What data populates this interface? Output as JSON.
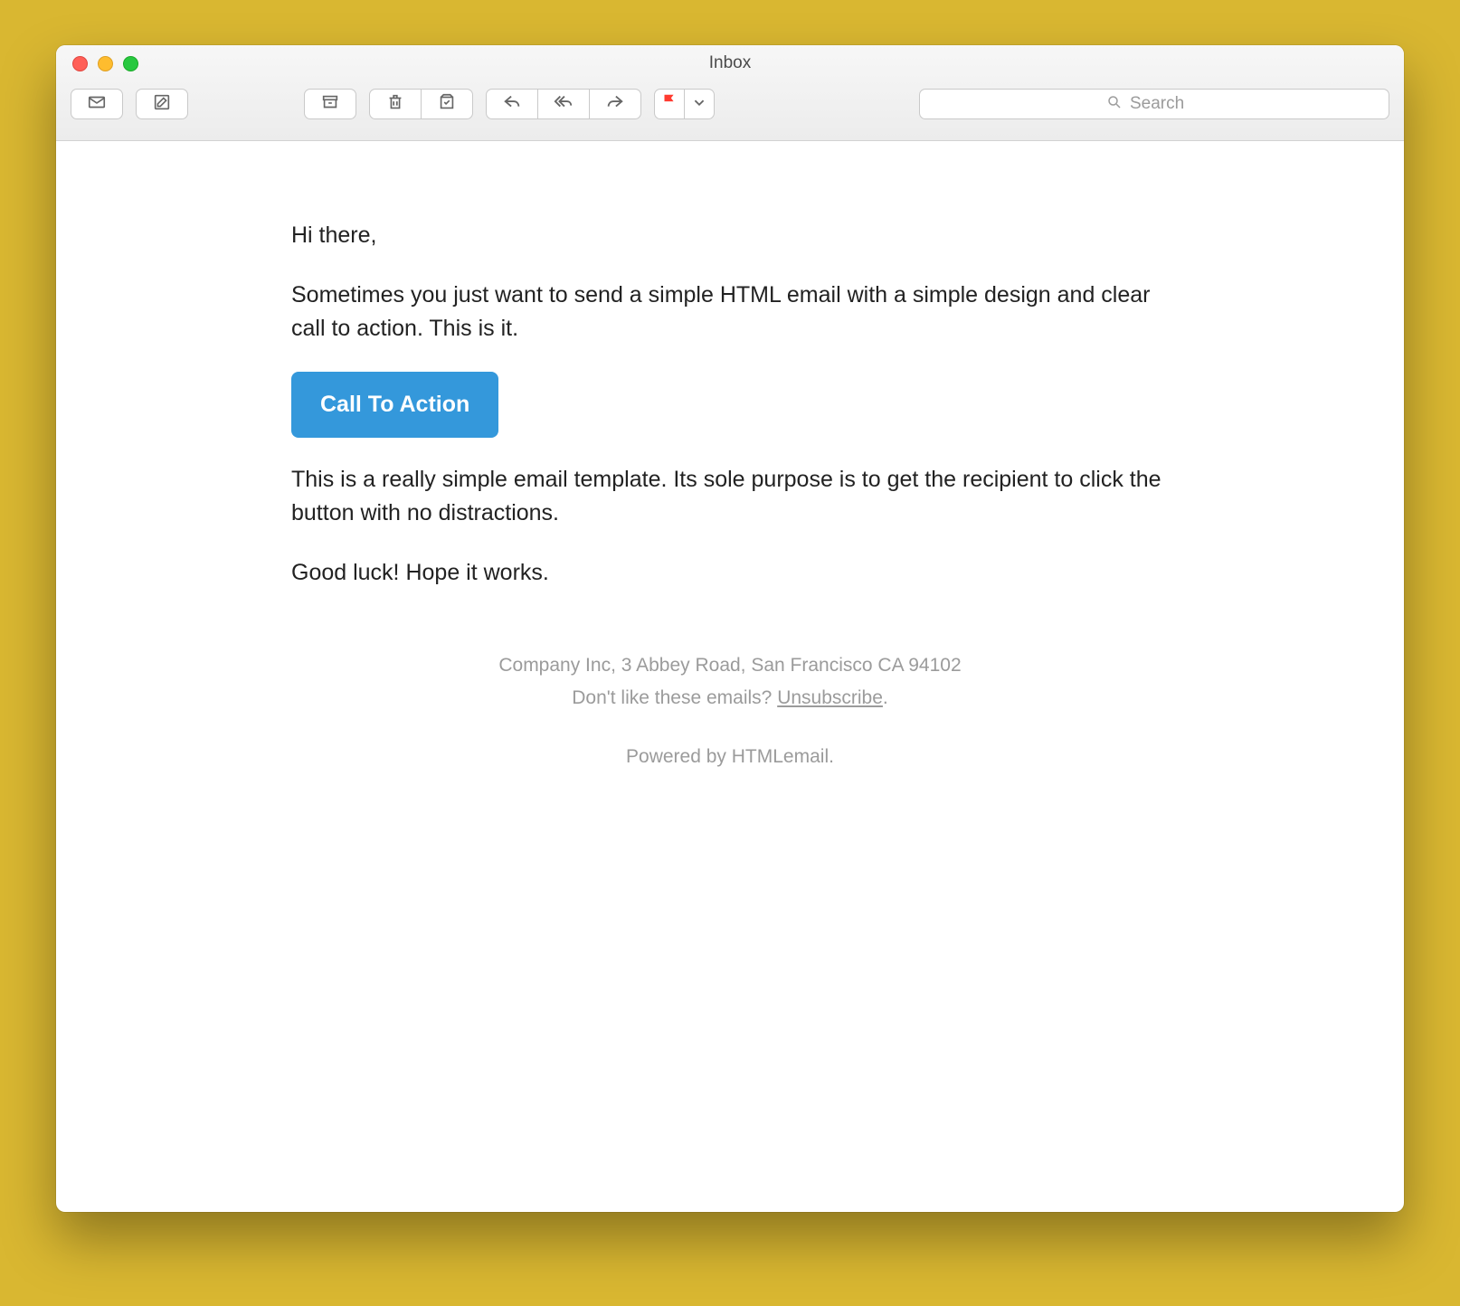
{
  "window": {
    "title": "Inbox"
  },
  "search": {
    "placeholder": "Search"
  },
  "email": {
    "greeting": "Hi there,",
    "intro": "Sometimes you just want to send a simple HTML email with a simple design and clear call to action. This is it.",
    "cta_label": "Call To Action",
    "body": "This is a really simple email template. Its sole purpose is to get the recipient to click the button with no distractions.",
    "closing": "Good luck! Hope it works."
  },
  "footer": {
    "address": "Company Inc, 3 Abbey Road, San Francisco CA 94102",
    "unsubscribe_prefix": "Don't like these emails? ",
    "unsubscribe_link": "Unsubscribe",
    "unsubscribe_suffix": ".",
    "powered": "Powered by HTMLemail."
  }
}
